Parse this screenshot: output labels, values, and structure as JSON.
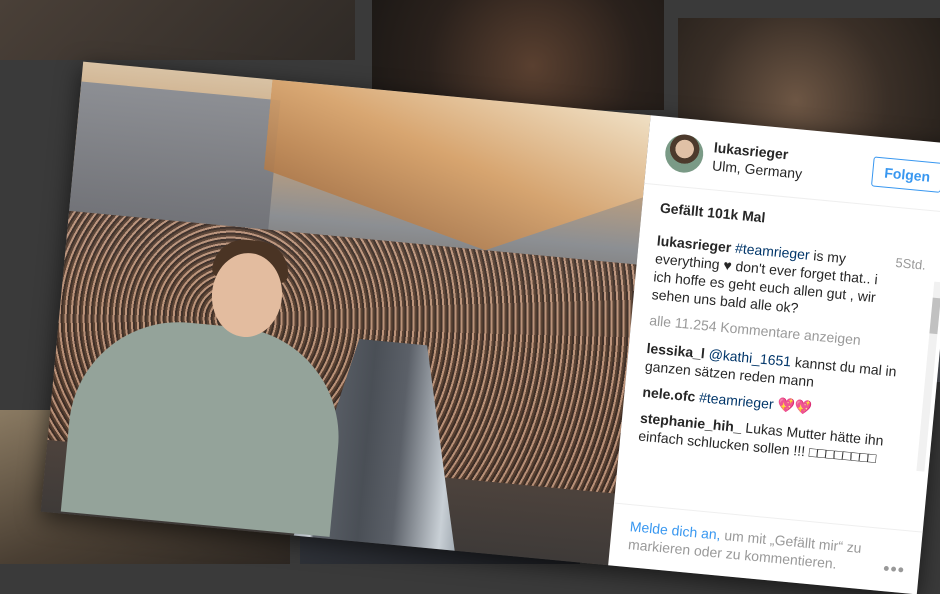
{
  "post": {
    "username": "lukasrieger",
    "location": "Ulm, Germany",
    "follow_label": "Folgen",
    "likes": "Gefällt 101k Mal",
    "timestamp": "5Std.",
    "caption": {
      "user": "lukasrieger",
      "hashtag": "#teamrieger",
      "text_1": " is my everything ",
      "heart": "♥",
      "text_2": " don't ever forget that.. i ich hoffe es geht euch allen gut , wir sehen uns bald alle ok?"
    },
    "load_more": "alle 11.254 Kommentare anzeigen",
    "comments": [
      {
        "user": "lessika_l",
        "mention": "@kathi_1651",
        "text": " kannst du mal in ganzen sätzen reden mann"
      },
      {
        "user": "nele.ofc",
        "mention": "#teamrieger",
        "text": " 💖💖"
      },
      {
        "user": "stephanie_hih_",
        "mention": "",
        "text": " Lukas Mutter hätte ihn einfach schlucken sollen !!! □□□□□□□□"
      }
    ],
    "footer": {
      "login_link": "Melde dich an,",
      "text": " um mit „Gefällt mir“ zu markieren oder zu kommentieren.",
      "more": "•••"
    }
  },
  "nav": {
    "next_arrow": "›"
  }
}
